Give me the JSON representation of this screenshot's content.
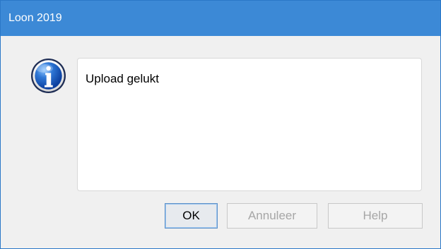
{
  "window": {
    "title": "Loon 2019",
    "titlebar_color": "#3c89d6"
  },
  "dialog": {
    "icon": "information-icon",
    "message": "Upload gelukt"
  },
  "buttons": {
    "ok_label": "OK",
    "cancel_label": "Annuleer",
    "help_label": "Help"
  }
}
